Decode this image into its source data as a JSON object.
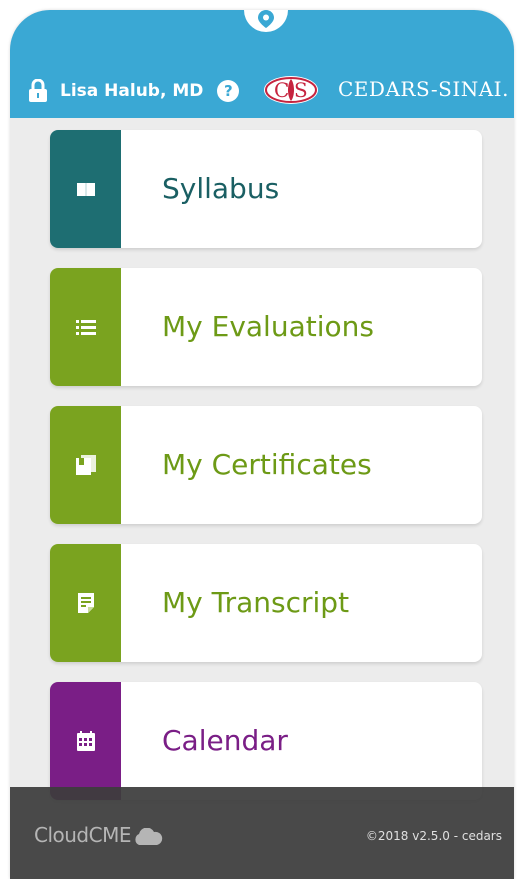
{
  "header": {
    "user_name": "Lisa Halub, MD",
    "help_label": "?",
    "logo_text": "CS",
    "brand_name": "CEDARS-SINAI.",
    "background_color": "#3aa8d4"
  },
  "menu": {
    "items": [
      {
        "label": "Syllabus",
        "icon": "book-icon",
        "color": "#1e6e72"
      },
      {
        "label": "My Evaluations",
        "icon": "list-icon",
        "color": "#7aa31f"
      },
      {
        "label": "My Certificates",
        "icon": "certificates-icon",
        "color": "#7aa31f"
      },
      {
        "label": "My Transcript",
        "icon": "document-icon",
        "color": "#7aa31f"
      },
      {
        "label": "Calendar",
        "icon": "calendar-icon",
        "color": "#7a1e86"
      }
    ]
  },
  "footer": {
    "brand": "CloudCME",
    "version": "©2018 v2.5.0 - cedars"
  }
}
